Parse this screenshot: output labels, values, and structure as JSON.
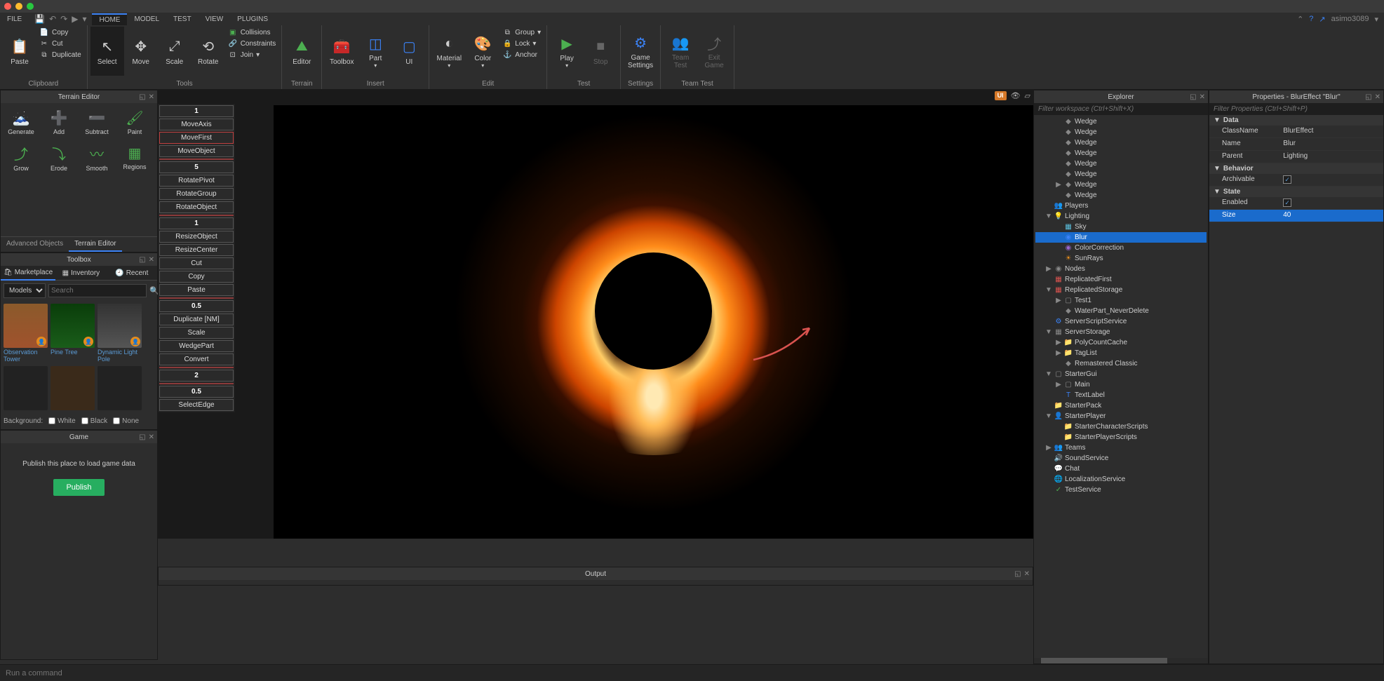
{
  "menubar": {
    "file": "FILE",
    "tabs": [
      "HOME",
      "MODEL",
      "TEST",
      "VIEW",
      "PLUGINS"
    ],
    "active_tab": "HOME",
    "user": "asimo3089"
  },
  "ribbon": {
    "clipboard": {
      "paste": "Paste",
      "copy": "Copy",
      "cut": "Cut",
      "duplicate": "Duplicate",
      "label": "Clipboard"
    },
    "tools": {
      "select": "Select",
      "move": "Move",
      "scale": "Scale",
      "rotate": "Rotate",
      "collisions": "Collisions",
      "constraints": "Constraints",
      "join": "Join",
      "label": "Tools"
    },
    "terrain": {
      "editor": "Editor",
      "label": "Terrain"
    },
    "insert": {
      "toolbox": "Toolbox",
      "part": "Part",
      "ui": "UI",
      "label": "Insert"
    },
    "edit": {
      "material": "Material",
      "color": "Color",
      "group": "Group",
      "lock": "Lock",
      "anchor": "Anchor",
      "label": "Edit"
    },
    "test": {
      "play": "Play",
      "stop": "Stop",
      "label": "Test"
    },
    "settings": {
      "game": "Game\nSettings",
      "label": "Settings"
    },
    "teamtest": {
      "team": "Team\nTest",
      "exit": "Exit\nGame",
      "label": "Team Test"
    }
  },
  "terrain_editor": {
    "title": "Terrain Editor",
    "buttons": [
      "Generate",
      "Add",
      "Subtract",
      "Paint",
      "Grow",
      "Erode",
      "Smooth",
      "Regions"
    ]
  },
  "left_tabs": {
    "adv": "Advanced Objects",
    "terrain": "Terrain Editor"
  },
  "toolbox": {
    "title": "Toolbox",
    "tabs": {
      "marketplace": "Marketplace",
      "inventory": "Inventory",
      "recent": "Recent"
    },
    "category": "Models",
    "search_ph": "Search",
    "assets": [
      {
        "name": "Observation Tower"
      },
      {
        "name": "Pine Tree"
      },
      {
        "name": "Dynamic Light Pole"
      }
    ],
    "bg_label": "Background:",
    "bg_opts": [
      "White",
      "Black",
      "None"
    ]
  },
  "game_panel": {
    "title": "Game",
    "msg": "Publish this place to load game data",
    "btn": "Publish"
  },
  "plugin": {
    "items": [
      {
        "t": "n",
        "v": "1"
      },
      {
        "t": "i",
        "v": "MoveAxis"
      },
      {
        "t": "i",
        "v": "MoveFirst",
        "hl": true
      },
      {
        "t": "i",
        "v": "MoveObject"
      },
      {
        "t": "n",
        "v": "5"
      },
      {
        "t": "i",
        "v": "RotatePivot"
      },
      {
        "t": "i",
        "v": "RotateGroup"
      },
      {
        "t": "i",
        "v": "RotateObject"
      },
      {
        "t": "n",
        "v": "1"
      },
      {
        "t": "i",
        "v": "ResizeObject"
      },
      {
        "t": "i",
        "v": "ResizeCenter"
      },
      {
        "t": "i",
        "v": "Cut"
      },
      {
        "t": "i",
        "v": "Copy"
      },
      {
        "t": "i",
        "v": "Paste"
      },
      {
        "t": "n",
        "v": "0.5"
      },
      {
        "t": "i",
        "v": "Duplicate [NM]"
      },
      {
        "t": "i",
        "v": "Scale"
      },
      {
        "t": "i",
        "v": "WedgePart"
      },
      {
        "t": "i",
        "v": "Convert"
      },
      {
        "t": "n",
        "v": "2"
      },
      {
        "t": "n",
        "v": "0.5"
      },
      {
        "t": "i",
        "v": "SelectEdge"
      }
    ]
  },
  "viewport": {
    "ui_badge": "UI"
  },
  "output": {
    "title": "Output"
  },
  "cmd": {
    "ph": "Run a command"
  },
  "explorer": {
    "title": "Explorer",
    "filter_ph": "Filter workspace (Ctrl+Shift+X)",
    "items": [
      {
        "indent": 2,
        "icon": "◆",
        "color": "c-gray",
        "label": "Wedge"
      },
      {
        "indent": 2,
        "icon": "◆",
        "color": "c-gray",
        "label": "Wedge"
      },
      {
        "indent": 2,
        "icon": "◆",
        "color": "c-gray",
        "label": "Wedge"
      },
      {
        "indent": 2,
        "icon": "◆",
        "color": "c-gray",
        "label": "Wedge"
      },
      {
        "indent": 2,
        "icon": "◆",
        "color": "c-gray",
        "label": "Wedge"
      },
      {
        "indent": 2,
        "icon": "◆",
        "color": "c-gray",
        "label": "Wedge"
      },
      {
        "indent": 2,
        "toggle": "▶",
        "icon": "◆",
        "color": "c-gray",
        "label": "Wedge"
      },
      {
        "indent": 2,
        "icon": "◆",
        "color": "c-gray",
        "label": "Wedge"
      },
      {
        "indent": 1,
        "icon": "👥",
        "color": "c-gray",
        "label": "Players"
      },
      {
        "indent": 1,
        "toggle": "▼",
        "icon": "💡",
        "color": "c-yellow",
        "label": "Lighting"
      },
      {
        "indent": 2,
        "icon": "▦",
        "color": "c-cyan",
        "label": "Sky"
      },
      {
        "indent": 2,
        "icon": "◉",
        "color": "c-blue",
        "label": "Blur",
        "selected": true
      },
      {
        "indent": 2,
        "icon": "◉",
        "color": "c-purple",
        "label": "ColorCorrection"
      },
      {
        "indent": 2,
        "icon": "☀",
        "color": "c-orange",
        "label": "SunRays"
      },
      {
        "indent": 1,
        "toggle": "▶",
        "icon": "◉",
        "color": "c-gray",
        "label": "Nodes"
      },
      {
        "indent": 1,
        "icon": "▦",
        "color": "c-red",
        "label": "ReplicatedFirst"
      },
      {
        "indent": 1,
        "toggle": "▼",
        "icon": "▦",
        "color": "c-red",
        "label": "ReplicatedStorage"
      },
      {
        "indent": 2,
        "toggle": "▶",
        "icon": "▢",
        "color": "c-gray",
        "label": "Test1"
      },
      {
        "indent": 2,
        "icon": "◆",
        "color": "c-gray",
        "label": "WaterPart_NeverDelete"
      },
      {
        "indent": 1,
        "icon": "⚙",
        "color": "c-blue",
        "label": "ServerScriptService"
      },
      {
        "indent": 1,
        "toggle": "▼",
        "icon": "▦",
        "color": "c-gray",
        "label": "ServerStorage"
      },
      {
        "indent": 2,
        "toggle": "▶",
        "icon": "📁",
        "color": "c-yellow",
        "label": "PolyCountCache"
      },
      {
        "indent": 2,
        "toggle": "▶",
        "icon": "📁",
        "color": "c-yellow",
        "label": "TagList"
      },
      {
        "indent": 2,
        "icon": "◆",
        "color": "c-gray",
        "label": "Remastered Classic"
      },
      {
        "indent": 1,
        "toggle": "▼",
        "icon": "▢",
        "color": "c-gray",
        "label": "StarterGui"
      },
      {
        "indent": 2,
        "toggle": "▶",
        "icon": "▢",
        "color": "c-gray",
        "label": "Main"
      },
      {
        "indent": 2,
        "icon": "T",
        "color": "c-blue",
        "label": "TextLabel"
      },
      {
        "indent": 1,
        "icon": "📁",
        "color": "c-yellow",
        "label": "StarterPack"
      },
      {
        "indent": 1,
        "toggle": "▼",
        "icon": "👤",
        "color": "c-gray",
        "label": "StarterPlayer"
      },
      {
        "indent": 2,
        "icon": "📁",
        "color": "c-yellow",
        "label": "StarterCharacterScripts"
      },
      {
        "indent": 2,
        "icon": "📁",
        "color": "c-yellow",
        "label": "StarterPlayerScripts"
      },
      {
        "indent": 1,
        "toggle": "▶",
        "icon": "👥",
        "color": "c-gray",
        "label": "Teams"
      },
      {
        "indent": 1,
        "icon": "🔊",
        "color": "c-gray",
        "label": "SoundService"
      },
      {
        "indent": 1,
        "icon": "💬",
        "color": "c-blue",
        "label": "Chat"
      },
      {
        "indent": 1,
        "icon": "🌐",
        "color": "c-cyan",
        "label": "LocalizationService"
      },
      {
        "indent": 1,
        "icon": "✓",
        "color": "c-green",
        "label": "TestService"
      }
    ]
  },
  "properties": {
    "title": "Properties - BlurEffect \"Blur\"",
    "filter_ph": "Filter Properties (Ctrl+Shift+P)",
    "sections": [
      {
        "name": "Data",
        "rows": [
          {
            "k": "ClassName",
            "v": "BlurEffect"
          },
          {
            "k": "Name",
            "v": "Blur"
          },
          {
            "k": "Parent",
            "v": "Lighting"
          }
        ]
      },
      {
        "name": "Behavior",
        "rows": [
          {
            "k": "Archivable",
            "v": "✓",
            "check": true
          }
        ]
      },
      {
        "name": "State",
        "rows": [
          {
            "k": "Enabled",
            "v": "✓",
            "check": true
          },
          {
            "k": "Size",
            "v": "40",
            "selected": true
          }
        ]
      }
    ]
  }
}
